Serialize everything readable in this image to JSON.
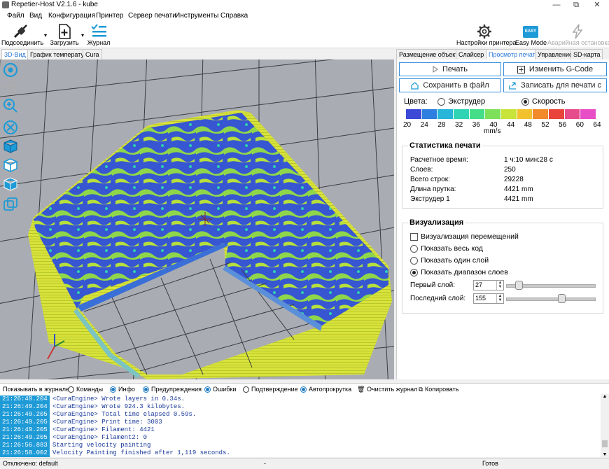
{
  "window": {
    "title": "Repetier-Host V2.1.6 - kube",
    "minimize": "—",
    "maximize": "⧉",
    "close": "✕"
  },
  "menu": [
    "Файл",
    "Вид",
    "Конфигурация",
    "Принтер",
    "Сервер печати",
    "Инструменты",
    "Справка"
  ],
  "toolbar": {
    "connect": "Подсоединить",
    "load": "Загрузить",
    "log": "Журнал",
    "printer_settings": "Настройки принтера",
    "easy_mode": "Easy Mode",
    "easy_badge": "EASY",
    "emergency": "Аварийная остановка"
  },
  "left_tabs": [
    "3D-Вид",
    "График температур",
    "Cura"
  ],
  "right_tabs": [
    "Размещение объекта",
    "Слайсер",
    "Просмотр печати",
    "Управление",
    "SD-карта"
  ],
  "actions": {
    "print": "Печать",
    "edit_gcode": "Изменить G-Code",
    "save_file": "Сохранить в файл",
    "write_sd": "Записать для печати с"
  },
  "colors": {
    "label": "Цвета:",
    "extruder": "Экструдер",
    "speed": "Скорость",
    "scale": [
      "#3b49d6",
      "#2d7fe0",
      "#27b5d9",
      "#2fd4b4",
      "#44dd88",
      "#7ee05a",
      "#c8e33a",
      "#f2c12e",
      "#f08a2a",
      "#e8443c",
      "#e64b8c",
      "#e84ec6"
    ],
    "ticks": [
      "20",
      "24",
      "28",
      "32",
      "36",
      "40",
      "44",
      "48",
      "52",
      "56",
      "60",
      "64"
    ],
    "unit": "mm/s"
  },
  "stats": {
    "title": "Статистика печати",
    "rows": [
      {
        "label": "Расчетное время:",
        "value": "1 ч:10 мин:28 с"
      },
      {
        "label": "Слоев:",
        "value": "250"
      },
      {
        "label": "Всего строк:",
        "value": "29228"
      },
      {
        "label": "Длина прутка:",
        "value": "4421 mm"
      },
      {
        "label": "Экструдер 1",
        "value": "4421 mm"
      }
    ]
  },
  "viz": {
    "title": "Визуализация",
    "travel": "Визуализация перемещений",
    "all_code": "Показать весь код",
    "one_layer": "Показать один слой",
    "layer_range": "Показать диапазон слоев",
    "first_label": "Первый слой:",
    "first_value": "27",
    "first_fraction": 0.108,
    "last_label": "Последний слой:",
    "last_value": "155",
    "last_fraction": 0.62,
    "spin_up": "▲",
    "spin_down": "▼"
  },
  "logbar": {
    "label": "Показывать в журнале:",
    "commands": "Команды",
    "info": "Инфо",
    "warnings": "Предупреждения",
    "errors": "Ошибки",
    "ack": "Подтверждение",
    "autoscroll": "Автопрокрутка",
    "clear": "Очистить журнал",
    "copy": "Копировать"
  },
  "log": [
    {
      "ts": "21:26:49.204",
      "msg": "<CuraEngine> Wrote layers in  0.34s."
    },
    {
      "ts": "21:26:49.204",
      "msg": "<CuraEngine> Wrote 924.3 kilobytes."
    },
    {
      "ts": "21:26:49.205",
      "msg": "<CuraEngine> Total time elapsed  0.59s."
    },
    {
      "ts": "21:26:49.205",
      "msg": "<CuraEngine> Print time: 3003"
    },
    {
      "ts": "21:26:49.205",
      "msg": "<CuraEngine> Filament: 4421"
    },
    {
      "ts": "21:26:49.205",
      "msg": "<CuraEngine> Filament2: 0"
    },
    {
      "ts": "21:26:56.883",
      "msg": "Starting velocity painting"
    },
    {
      "ts": "21:26:58.002",
      "msg": "Velocity Painting finished after 1,119 seconds."
    }
  ],
  "status": {
    "left": "Отключено: default",
    "mid": "-",
    "right": "Готов"
  },
  "scroll": {
    "up": "▲",
    "down": "▼"
  }
}
